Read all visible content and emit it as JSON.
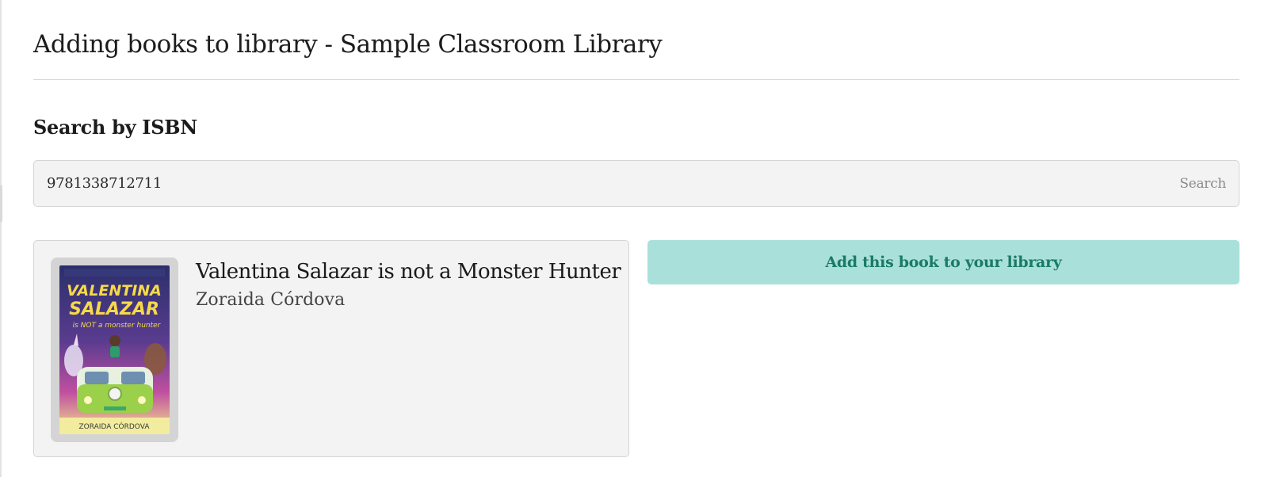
{
  "page": {
    "title": "Adding books to library - Sample Classroom Library"
  },
  "search": {
    "heading": "Search by ISBN",
    "value": "9781338712711",
    "button_label": "Search"
  },
  "result": {
    "title": "Valentina Salazar is not a Monster Hunter",
    "author": "Zoraida Córdova",
    "cover": {
      "title_line1": "VALENTINA",
      "title_line2": "SALAZAR",
      "subtitle": "is NOT a monster hunter",
      "author": "ZORAIDA CÓRDOVA"
    }
  },
  "actions": {
    "add_label": "Add this book to your library"
  },
  "colors": {
    "accent_bg": "#a9e1da",
    "accent_text": "#1b7a66",
    "card_bg": "#f3f3f3"
  }
}
